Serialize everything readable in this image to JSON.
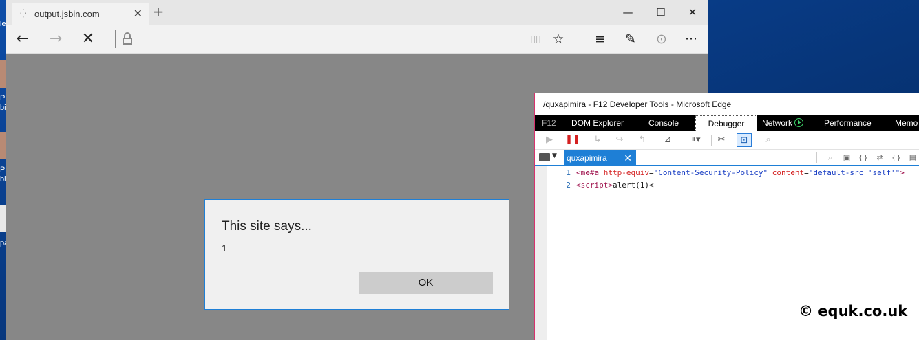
{
  "browser": {
    "tab_title": "output.jsbin.com",
    "tab_close": "✕",
    "new_tab": "+",
    "window_buttons": {
      "minimize": "—",
      "maximize": "☐",
      "close": "✕"
    },
    "nav": {
      "back": "←",
      "forward": "→",
      "stop": "✕"
    },
    "tools": {
      "reading_view": "▯▯",
      "favorites": "☆",
      "hub": "≡",
      "web_note": "✎",
      "share": "⊙",
      "more": "···"
    }
  },
  "dialog": {
    "title": "This site says...",
    "message": "1",
    "ok_label": "OK"
  },
  "devtools": {
    "window_title": "/quxapimira - F12 Developer Tools - Microsoft Edge",
    "tabs": [
      {
        "label": "F12"
      },
      {
        "label": "DOM Explorer"
      },
      {
        "label": "Console"
      },
      {
        "label": "Debugger"
      },
      {
        "label": "Network"
      },
      {
        "label": "Performance"
      },
      {
        "label": "Memo"
      }
    ],
    "active_tab": "Debugger",
    "file_tab": "quxapimira",
    "file_tab_close": "✕",
    "code": {
      "line1": {
        "num": "1",
        "open": "<me#a",
        "attr1": " http-equiv",
        "eq1": "=",
        "val1": "\"Content-Security-Policy\"",
        "attr2": " content",
        "eq2": "=",
        "val2": "\"default-src 'self'\"",
        "close": ">"
      },
      "line2": {
        "num": "2",
        "open": "<script>",
        "text": "alert(1)<"
      }
    }
  },
  "watermark": "© equk.co.uk",
  "desktop": {
    "labels": [
      "le",
      "P",
      "bi",
      "P",
      "bi",
      "pa"
    ]
  }
}
